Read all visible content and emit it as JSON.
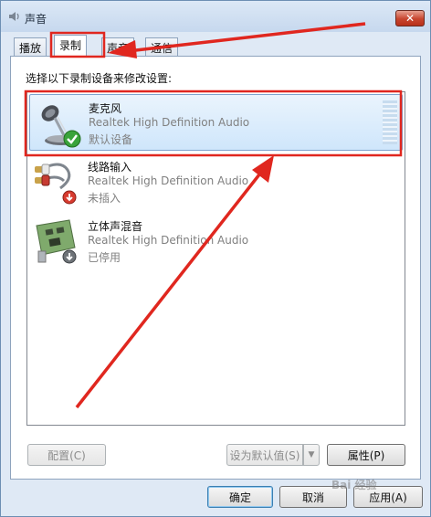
{
  "window": {
    "title": "声音",
    "close_icon": "close-icon",
    "title_icon": "speaker-icon"
  },
  "tabs": [
    {
      "label": "播放",
      "active": false
    },
    {
      "label": "录制",
      "active": true
    },
    {
      "label": "声音",
      "active": false
    },
    {
      "label": "通信",
      "active": false
    }
  ],
  "instruction": "选择以下录制设备来修改设置:",
  "devices": [
    {
      "name": "麦克风",
      "driver": "Realtek High Definition Audio",
      "status": "默认设备",
      "icon": "microphone-icon",
      "badge": "green-check-icon",
      "selected": true
    },
    {
      "name": "线路输入",
      "driver": "Realtek High Definition Audio",
      "status": "未插入",
      "icon": "line-in-cable-icon",
      "badge": "red-down-arrow-icon",
      "selected": false
    },
    {
      "name": "立体声混音",
      "driver": "Realtek High Definition Audio",
      "status": "已停用",
      "icon": "sound-card-icon",
      "badge": "gray-down-arrow-icon",
      "selected": false
    }
  ],
  "buttons": {
    "configure": "配置(C)",
    "set_default": "设为默认值(S)",
    "properties": "属性(P)",
    "ok": "确定",
    "cancel": "取消",
    "apply": "应用(A)"
  },
  "watermark": "Bai 经验",
  "colors": {
    "annotation_red": "#e0271f",
    "selection_blue": "#cfe6fb",
    "check_green": "#3aa33a"
  }
}
